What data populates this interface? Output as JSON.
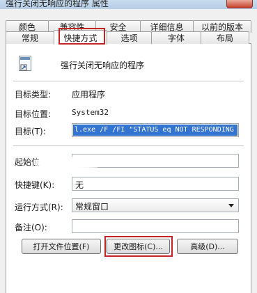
{
  "window": {
    "title": "强行关闭无响应的程序 属性"
  },
  "tabs_back": [
    "颜色",
    "兼容性",
    "安全",
    "详细信息",
    "以前的版本"
  ],
  "tabs_front": [
    "常规",
    "快捷方式",
    "选项",
    "字体",
    "布局"
  ],
  "active_tab": "快捷方式",
  "shortcut": {
    "name": "强行关闭无响应的程序",
    "target_type_label": "目标类型:",
    "target_type_value": "应用程序",
    "target_location_label": "目标位置:",
    "target_location_value": "System32",
    "target_label": "目标(T):",
    "target_value": "l.exe /F /FI \"STATUS eq NOT RESPONDING",
    "start_in_label": "起始位",
    "hotkey_label": "快捷键(K):",
    "hotkey_value": "无",
    "run_label": "运行方式(R):",
    "run_value": "常规窗口",
    "comment_label": "备注(O):",
    "comment_value": ""
  },
  "buttons": {
    "open_location": "打开文件位置(F)",
    "change_icon": "更改图标(C)...",
    "advanced": "高级(D)..."
  },
  "colors": {
    "highlight_border": "#c42424",
    "selection": "#3374d1"
  }
}
